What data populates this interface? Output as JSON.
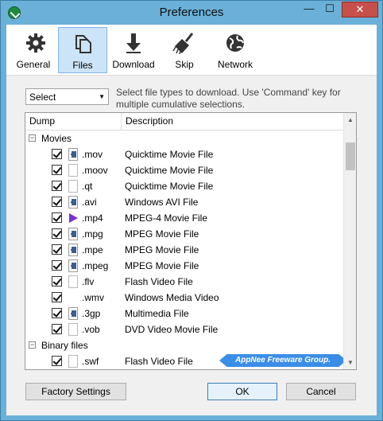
{
  "window": {
    "title": "Preferences",
    "minimize": "—",
    "maximize": "☐",
    "close": "✕"
  },
  "toolbar": {
    "items": [
      {
        "label": "General",
        "icon": "gear-icon"
      },
      {
        "label": "Files",
        "icon": "files-icon",
        "active": true
      },
      {
        "label": "Download",
        "icon": "download-icon"
      },
      {
        "label": "Skip",
        "icon": "broom-icon"
      },
      {
        "label": "Network",
        "icon": "globe-icon"
      }
    ]
  },
  "filter": {
    "select_value": "Select",
    "hint": "Select file types to download. Use 'Command' key for multiple cumulative selections."
  },
  "table": {
    "headers": [
      "Dump",
      "Description"
    ],
    "groups": [
      {
        "label": "Movies",
        "expander": "−"
      },
      {
        "label": "Binary files",
        "expander": "−"
      }
    ],
    "rows": [
      {
        "ext": ".mov",
        "desc": "Quicktime Movie File",
        "checked": true,
        "icon": "movie-file-icon"
      },
      {
        "ext": ".moov",
        "desc": "Quicktime Movie File",
        "checked": true,
        "icon": "blank-file-icon"
      },
      {
        "ext": ".qt",
        "desc": "Quicktime Movie File",
        "checked": true,
        "icon": "blank-file-icon"
      },
      {
        "ext": ".avi",
        "desc": "Windows AVI File",
        "checked": true,
        "icon": "movie-file-icon"
      },
      {
        "ext": ".mp4",
        "desc": "MPEG-4 Movie File",
        "checked": true,
        "icon": "mp4-play-icon"
      },
      {
        "ext": ".mpg",
        "desc": "MPEG Movie File",
        "checked": true,
        "icon": "movie-file-icon"
      },
      {
        "ext": ".mpe",
        "desc": "MPEG Movie File",
        "checked": true,
        "icon": "movie-file-icon"
      },
      {
        "ext": ".mpeg",
        "desc": "MPEG Movie File",
        "checked": true,
        "icon": "movie-file-icon"
      },
      {
        "ext": ".flv",
        "desc": "Flash Video File",
        "checked": true,
        "icon": "blank-file-icon"
      },
      {
        "ext": ".wmv",
        "desc": "Windows Media Video",
        "checked": true,
        "icon": "no-icon"
      },
      {
        "ext": ".3gp",
        "desc": "Multimedia File",
        "checked": true,
        "icon": "movie-file-icon"
      },
      {
        "ext": ".vob",
        "desc": "DVD Video Movie File",
        "checked": true,
        "icon": "blank-file-icon"
      },
      {
        "ext": ".swf",
        "desc": "Flash Video File",
        "checked": true,
        "icon": "blank-file-icon"
      }
    ]
  },
  "watermark": "AppNee Freeware Group.",
  "buttons": {
    "factory": "Factory Settings",
    "ok": "OK",
    "cancel": "Cancel"
  },
  "colors": {
    "titlebar": "#6ab0d8",
    "active_tool": "#cce4f7",
    "close_button": "#c7504a",
    "watermark": "#3a8ee6"
  }
}
